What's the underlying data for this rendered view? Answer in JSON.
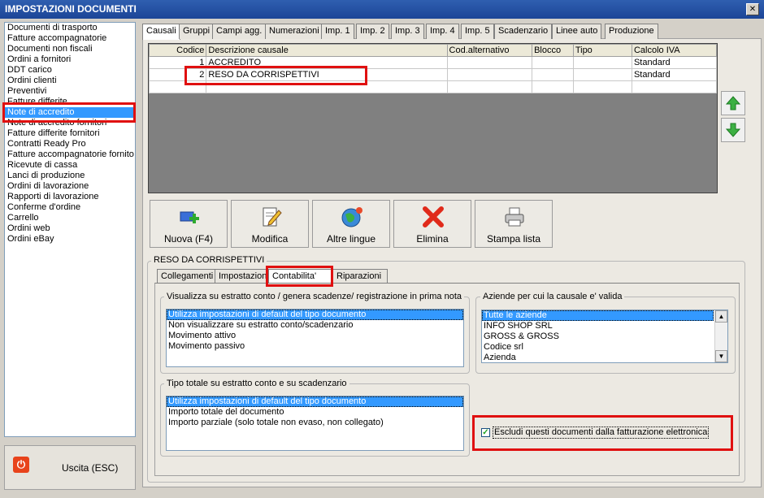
{
  "window": {
    "title": "IMPOSTAZIONI DOCUMENTI",
    "close_glyph": "✕"
  },
  "sidebar": {
    "items": [
      "Documenti di trasporto",
      "Fatture accompagnatorie",
      "Documenti non fiscali",
      "Ordini a fornitori",
      "DDT carico",
      "Ordini clienti",
      "Preventivi",
      "Fatture differite",
      "Note di accredito",
      "Note di accredito fornitori",
      "Fatture differite fornitori",
      "Contratti Ready Pro",
      "Fatture accompagnatorie fornito",
      "Ricevute di cassa",
      "Lanci di produzione",
      "Ordini di lavorazione",
      "Rapporti di lavorazione",
      "Conferme d'ordine",
      "Carrello",
      "Ordini web",
      "Ordini eBay"
    ],
    "selected_index": 8
  },
  "exit_button": {
    "label": "Uscita (ESC)",
    "icon": "power-icon"
  },
  "tabs": [
    "Causali",
    "Gruppi",
    "Campi agg.",
    "Numerazioni",
    "Imp. 1",
    "Imp. 2",
    "Imp. 3",
    "Imp. 4",
    "Imp. 5",
    "Scadenzario",
    "Linee auto",
    "Produzione"
  ],
  "grid": {
    "columns": [
      "Codice",
      "Descrizione causale",
      "Cod.alternativo",
      "Blocco",
      "Tipo",
      "Calcolo IVA"
    ],
    "rows": [
      [
        "1",
        "ACCREDITO",
        "",
        "",
        "",
        "Standard"
      ],
      [
        "2",
        "RESO DA CORRISPETTIVI",
        "",
        "",
        "",
        "Standard"
      ],
      [
        "",
        "",
        "",
        "",
        "",
        ""
      ]
    ]
  },
  "side_arrows": {
    "up_icon": "arrow-up-icon",
    "down_icon": "arrow-down-icon"
  },
  "actions": [
    {
      "label": "Nuova (F4)",
      "icon": "new-document-icon"
    },
    {
      "label": "Modifica",
      "icon": "edit-document-icon"
    },
    {
      "label": "Altre lingue",
      "icon": "globe-icon"
    },
    {
      "label": "Elimina",
      "icon": "delete-x-icon"
    },
    {
      "label": "Stampa lista",
      "icon": "printer-icon"
    }
  ],
  "detail": {
    "title": "RESO DA CORRISPETTIVI",
    "subtabs": [
      "Collegamenti",
      "Impostazioni",
      "Contabilita'",
      "Riparazioni"
    ],
    "active_subtab": 2,
    "visualizza": {
      "title": "Visualizza su estratto conto / genera scadenze/ registrazione  in prima nota",
      "options": [
        "Utilizza impostazioni di default del tipo documento",
        "Non visualizzare su estratto conto/scadenzario",
        "Movimento attivo",
        "Movimento passivo"
      ]
    },
    "aziende": {
      "title": "Aziende per cui la causale e' valida",
      "options": [
        "Tutte le aziende",
        "INFO SHOP SRL",
        "GROSS & GROSS",
        "Codice srl",
        "Azienda"
      ]
    },
    "tipo_totale": {
      "title": "Tipo totale su estratto conto e su scadenzario",
      "options": [
        "Utilizza impostazioni di default del tipo documento",
        "Importo totale del documento",
        "Importo parziale (solo totale non evaso, non collegato)"
      ]
    },
    "escludi": {
      "label": "Escludi questi documenti dalla fatturazione elettronica",
      "checked": true,
      "check_glyph": "✓"
    }
  }
}
